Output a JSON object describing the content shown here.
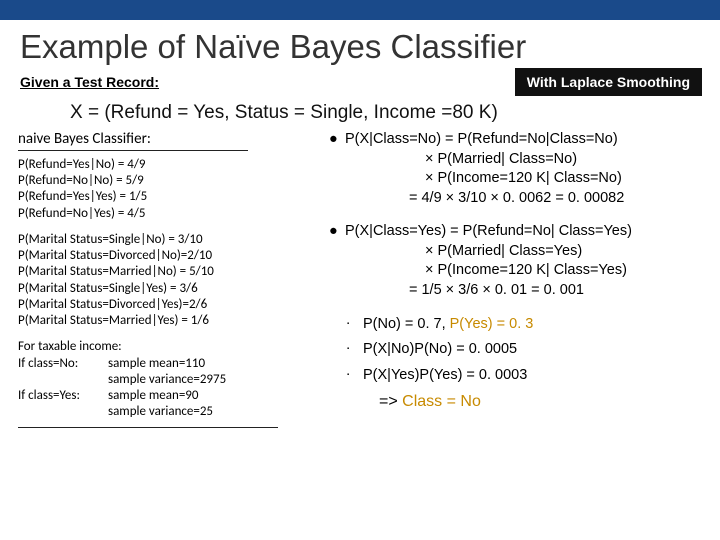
{
  "title": "Example of Naïve Bayes Classifier",
  "given_label": "Given a Test Record:",
  "smoothing": "With Laplace Smoothing",
  "record": "X = (Refund = Yes, Status = Single, Income =80 K)",
  "left": {
    "header": "naive Bayes Classifier:",
    "refund": [
      "P(Refund=Yes|No) = 4/9",
      "P(Refund=No|No) = 5/9",
      "P(Refund=Yes|Yes) = 1/5",
      "P(Refund=No|Yes) = 4/5"
    ],
    "marital": [
      "P(Marital Status=Single|No) = 3/10",
      "P(Marital Status=Divorced|No)=2/10",
      "P(Marital Status=Married|No) = 5/10",
      "P(Marital Status=Single|Yes) = 3/6",
      "P(Marital Status=Divorced|Yes)=2/6",
      "P(Marital Status=Married|Yes) = 1/6"
    ],
    "income_header": "For taxable income:",
    "income_no_label": "If class=No:",
    "income_no_mean": "sample mean=110",
    "income_no_var": "sample variance=2975",
    "income_yes_label": "If class=Yes:",
    "income_yes_mean": "sample mean=90",
    "income_yes_var": "sample variance=25"
  },
  "right": {
    "no": {
      "l1": "P(X|Class=No) = P(Refund=No|Class=No)",
      "l2": "× P(Married| Class=No)",
      "l3": "× P(Income=120 K| Class=No)",
      "l4": "= 4/9 × 3/10 × 0. 0062 = 0. 00082"
    },
    "yes": {
      "l1": "P(X|Class=Yes) = P(Refund=No| Class=Yes)",
      "l2": "× P(Married| Class=Yes)",
      "l3": "× P(Income=120 K| Class=Yes)",
      "l4": "= 1/5 × 3/6 × 0. 01 = 0. 001"
    },
    "prior_no": "P(No) = 0. 7, ",
    "prior_yes": "P(Yes) = 0. 3",
    "post_no": "P(X|No)P(No) = 0. 0005",
    "post_yes": "P(X|Yes)P(Yes) = 0. 0003",
    "arrow": "=> ",
    "concl": "Class = No"
  }
}
